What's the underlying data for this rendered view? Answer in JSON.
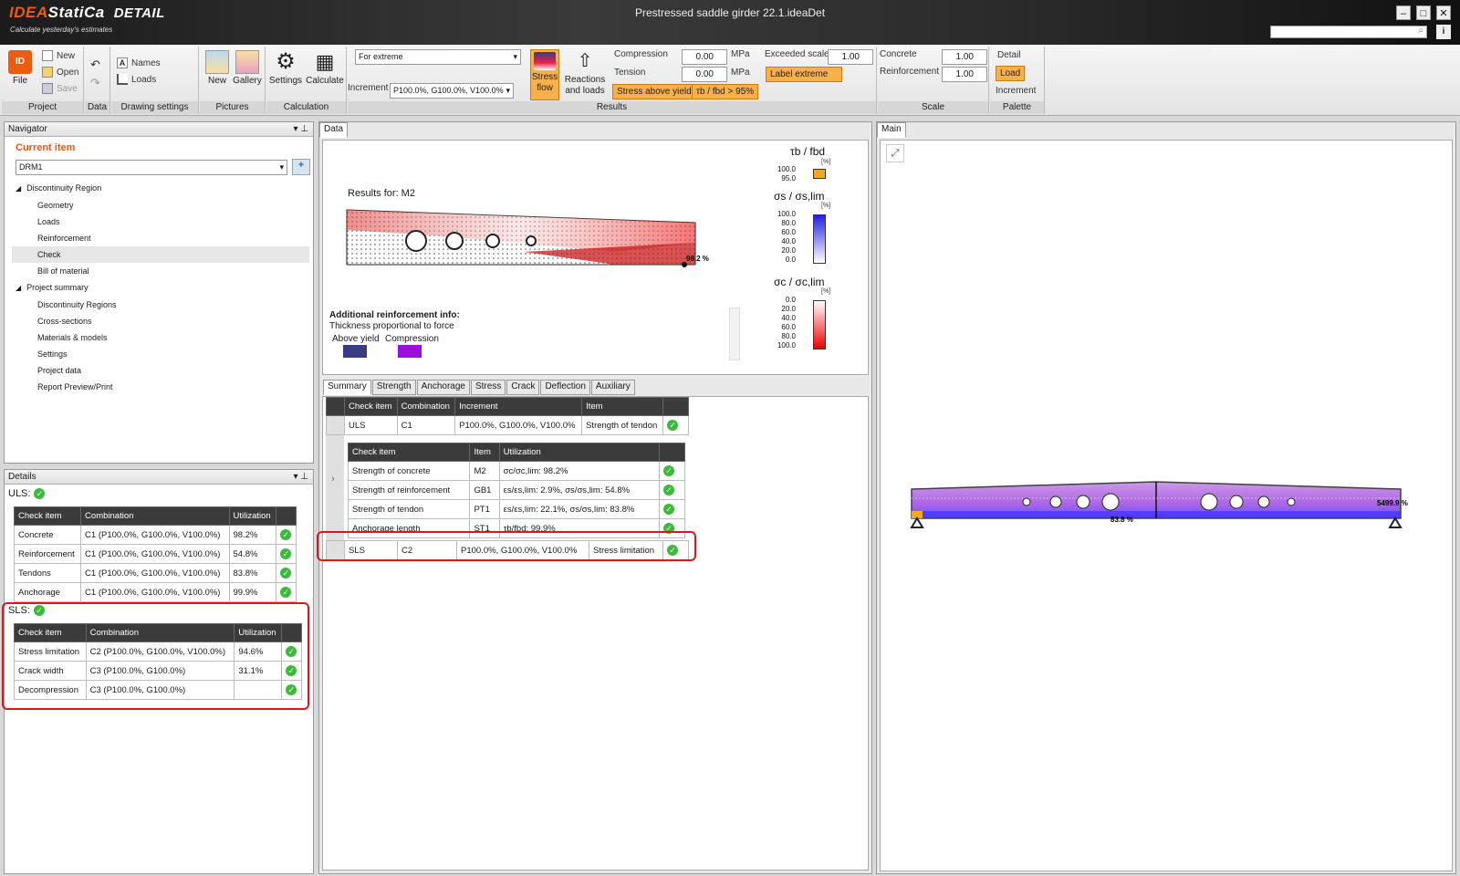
{
  "app": {
    "brand_idea": "IDEA",
    "brand_statica": "StatiCa",
    "brand_detail": "DETAIL",
    "tagline": "Calculate yesterday's estimates",
    "window_title": "Prestressed saddle girder 22.1.ideaDet"
  },
  "ribbon": {
    "file": "File",
    "new": "New",
    "open": "Open",
    "save": "Save",
    "names": "Names",
    "loads": "Loads",
    "pic_new": "New",
    "gallery": "Gallery",
    "settings": "Settings",
    "calculate": "Calculate",
    "extreme_combo": "For extreme",
    "increment_label": "Increment",
    "increment_value": "P100.0%, G100.0%, V100.0%",
    "stress_flow": "Stress flow",
    "reactions": "Reactions and loads",
    "compression": "Compression",
    "tension": "Tension",
    "comp_val": "0.00",
    "tens_val": "0.00",
    "mpa1": "MPa",
    "mpa2": "MPa",
    "stress_above_yield": "Stress above yield",
    "tb_fbd": "τb / fbd > 95%",
    "exceeded_scale": "Exceeded scale",
    "exceeded_val": "1.00",
    "label_extreme": "Label extreme",
    "concrete": "Concrete",
    "reinforcement": "Reinforcement",
    "conc_val": "1.00",
    "reinf_val": "1.00",
    "detail": "Detail",
    "load": "Load",
    "increment": "Increment",
    "groups": [
      "Project",
      "Data",
      "Drawing settings",
      "Pictures",
      "Calculation",
      "Results",
      "Scale",
      "Palette"
    ]
  },
  "navigator": {
    "title": "Navigator",
    "current_item": "Current item",
    "combo": "DRM1",
    "tree": [
      {
        "label": "Discontinuity Region",
        "level": 0
      },
      {
        "label": "Geometry",
        "level": 1
      },
      {
        "label": "Loads",
        "level": 1
      },
      {
        "label": "Reinforcement",
        "level": 1
      },
      {
        "label": "Check",
        "level": 1
      },
      {
        "label": "Bill of material",
        "level": 1
      },
      {
        "label": "Project summary",
        "level": 0
      },
      {
        "label": "Discontinuity Regions",
        "level": 1
      },
      {
        "label": "Cross-sections",
        "level": 1
      },
      {
        "label": "Materials & models",
        "level": 1
      },
      {
        "label": "Settings",
        "level": 1
      },
      {
        "label": "Project data",
        "level": 1
      },
      {
        "label": "Report Preview/Print",
        "level": 1
      }
    ]
  },
  "details": {
    "title": "Details",
    "uls": "ULS:",
    "sls": "SLS:",
    "headers": [
      "Check item",
      "Combination",
      "Utilization"
    ],
    "uls_rows": [
      [
        "Concrete",
        "C1 (P100.0%, G100.0%, V100.0%)",
        "98.2%"
      ],
      [
        "Reinforcement",
        "C1 (P100.0%, G100.0%, V100.0%)",
        "54.8%"
      ],
      [
        "Tendons",
        "C1 (P100.0%, G100.0%, V100.0%)",
        "83.8%"
      ],
      [
        "Anchorage",
        "C1 (P100.0%, G100.0%, V100.0%)",
        "99.9%"
      ]
    ],
    "sls_rows": [
      [
        "Stress limitation",
        "C2 (P100.0%, G100.0%, V100.0%)",
        "94.6%"
      ],
      [
        "Crack width",
        "C3 (P100.0%, G100.0%)",
        "31.1%"
      ],
      [
        "Decompression",
        "C3 (P100.0%, G100.0%)",
        ""
      ]
    ]
  },
  "data_panel": {
    "tab": "Data",
    "results_for": "Results for: M2",
    "max_label": "98.2 %",
    "add_info_title": "Additional reinforcement info:",
    "add_info_sub": "Thickness proportional to force",
    "above_yield": "Above yield",
    "compression": "Compression",
    "legend1_title": "τb / fbd",
    "legend1_unit": "[%]",
    "legend1_vals": [
      "100.0",
      "95.0"
    ],
    "legend2_title": "σs / σs,lim",
    "legend2_unit": "[%]",
    "legend2_vals": [
      "100.0",
      "80.0",
      "60.0",
      "40.0",
      "20.0",
      "0.0"
    ],
    "legend3_title": "σc / σc,lim",
    "legend3_unit": "[%]",
    "legend3_vals": [
      "0.0",
      "20.0",
      "40.0",
      "60.0",
      "80.0",
      "100.0"
    ],
    "tabs": [
      "Summary",
      "Strength",
      "Anchorage",
      "Stress",
      "Crack",
      "Deflection",
      "Auxiliary"
    ],
    "main_headers": [
      "Check item",
      "Combination",
      "Increment",
      "Item"
    ],
    "uls_row": [
      "ULS",
      "C1",
      "P100.0%, G100.0%, V100.0%",
      "Strength of tendon"
    ],
    "sub_headers": [
      "Check item",
      "Item",
      "Utilization"
    ],
    "sub_rows": [
      [
        "Strength of concrete",
        "M2",
        "σc/σc,lim: 98.2%"
      ],
      [
        "Strength of reinforcement",
        "GB1",
        "εs/εs,lim: 2.9%, σs/σs,lim: 54.8%"
      ],
      [
        "Strength of tendon",
        "PT1",
        "εs/εs,lim: 22.1%, σs/σs,lim: 83.8%"
      ],
      [
        "Anchorage length",
        "ST1",
        "τb/fbd: 99.9%"
      ]
    ],
    "sls_row": [
      "SLS",
      "C2",
      "P100.0%, G100.0%, V100.0%",
      "Stress limitation"
    ]
  },
  "main_panel": {
    "tab": "Main",
    "label_mid": "83.8 %",
    "label_right": "5499.9 %"
  },
  "colors": {
    "accent": "#e85d10",
    "ok": "#3cba3c",
    "highlight": "#e0141a",
    "above_yield": "#3a3a8a",
    "compression": "#9a10d8"
  }
}
